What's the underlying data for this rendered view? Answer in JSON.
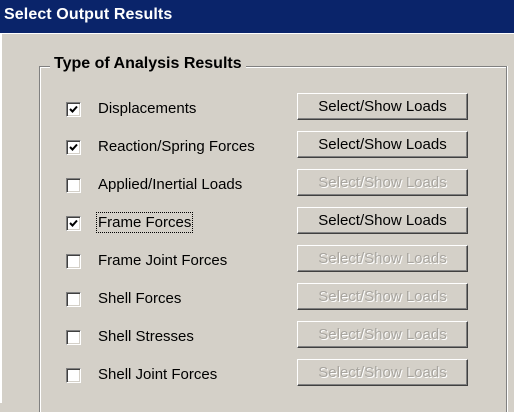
{
  "window": {
    "title": "Select Output Results"
  },
  "group": {
    "title": "Type of Analysis Results"
  },
  "rows": [
    {
      "label": "Displacements",
      "checked": true,
      "button": "Select/Show Loads",
      "button_enabled": true
    },
    {
      "label": "Reaction/Spring Forces",
      "checked": true,
      "button": "Select/Show Loads",
      "button_enabled": true
    },
    {
      "label": "Applied/Inertial Loads",
      "checked": false,
      "button": "Select/Show Loads",
      "button_enabled": false
    },
    {
      "label": "Frame Forces",
      "checked": true,
      "button": "Select/Show Loads",
      "button_enabled": true,
      "focused": true
    },
    {
      "label": "Frame Joint Forces",
      "checked": false,
      "button": "Select/Show Loads",
      "button_enabled": false
    },
    {
      "label": "Shell Forces",
      "checked": false,
      "button": "Select/Show Loads",
      "button_enabled": false
    },
    {
      "label": "Shell Stresses",
      "checked": false,
      "button": "Select/Show Loads",
      "button_enabled": false
    },
    {
      "label": "Shell Joint Forces",
      "checked": false,
      "button": "Select/Show Loads",
      "button_enabled": false
    }
  ]
}
